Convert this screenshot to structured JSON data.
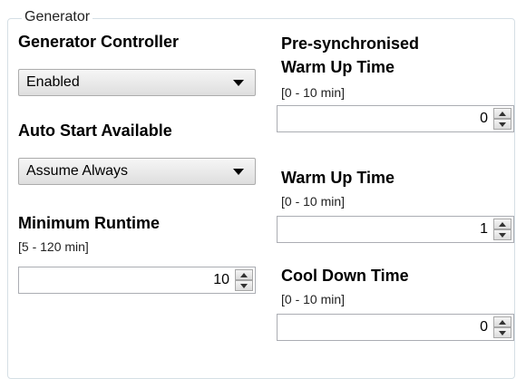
{
  "group": {
    "title": "Generator"
  },
  "generator_controller": {
    "label": "Generator Controller",
    "value": "Enabled",
    "icon": "chevron-down-icon"
  },
  "auto_start": {
    "label": "Auto Start Available",
    "value": "Assume Always",
    "icon": "chevron-down-icon"
  },
  "minimum_runtime": {
    "label": "Minimum Runtime",
    "range": "[5 - 120 min]",
    "value": "10"
  },
  "presync_warmup": {
    "label_line1": "Pre-synchronised",
    "label_line2": "Warm Up Time",
    "range": "[0 - 10 min]",
    "value": "0"
  },
  "warmup": {
    "label": "Warm Up Time",
    "range": "[0 - 10 min]",
    "value": "1"
  },
  "cooldown": {
    "label": "Cool Down Time",
    "range": "[0 - 10 min]",
    "value": "0"
  }
}
